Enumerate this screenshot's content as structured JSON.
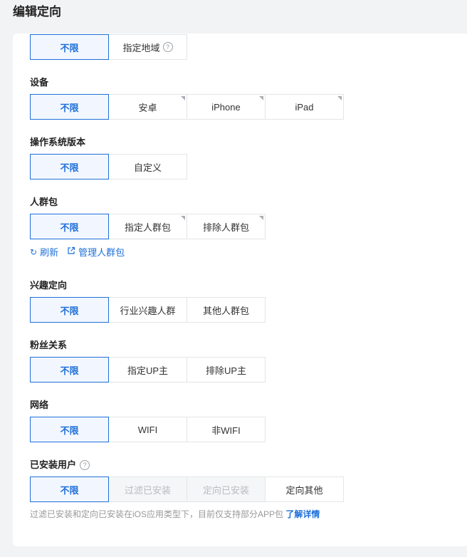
{
  "page": {
    "title": "编辑定向"
  },
  "region": {
    "options": [
      {
        "label": "不限",
        "selected": true
      },
      {
        "label": "指定地域",
        "help_icon": "question-circle-icon"
      }
    ]
  },
  "device": {
    "label": "设备",
    "options": [
      {
        "label": "不限",
        "selected": true
      },
      {
        "label": "安卓",
        "corner": true
      },
      {
        "label": "iPhone",
        "corner": true
      },
      {
        "label": "iPad",
        "corner": true
      }
    ]
  },
  "os_version": {
    "label": "操作系统版本",
    "options": [
      {
        "label": "不限",
        "selected": true
      },
      {
        "label": "自定义"
      }
    ]
  },
  "crowd": {
    "label": "人群包",
    "options": [
      {
        "label": "不限",
        "selected": true
      },
      {
        "label": "指定人群包",
        "corner": true
      },
      {
        "label": "排除人群包",
        "corner": true
      }
    ],
    "refresh_label": "刷新",
    "manage_label": "管理人群包"
  },
  "interest": {
    "label": "兴趣定向",
    "options": [
      {
        "label": "不限",
        "selected": true
      },
      {
        "label": "行业兴趣人群"
      },
      {
        "label": "其他人群包"
      }
    ]
  },
  "fans": {
    "label": "粉丝关系",
    "options": [
      {
        "label": "不限",
        "selected": true
      },
      {
        "label": "指定UP主"
      },
      {
        "label": "排除UP主"
      }
    ]
  },
  "network": {
    "label": "网络",
    "options": [
      {
        "label": "不限",
        "selected": true
      },
      {
        "label": "WIFI"
      },
      {
        "label": "非WIFI"
      }
    ]
  },
  "installed": {
    "label": "已安装用户",
    "options": [
      {
        "label": "不限",
        "selected": true
      },
      {
        "label": "过滤已安装",
        "disabled": true
      },
      {
        "label": "定向已安装",
        "disabled": true
      },
      {
        "label": "定向其他"
      }
    ],
    "note": "过滤已安装和定向已安装在iOS应用类型下，目前仅支持部分APP包",
    "more_label": "了解详情"
  },
  "colors": {
    "accent": "#1e6fd9",
    "border": "#e3e5e8",
    "page_bg": "#f2f3f5"
  }
}
